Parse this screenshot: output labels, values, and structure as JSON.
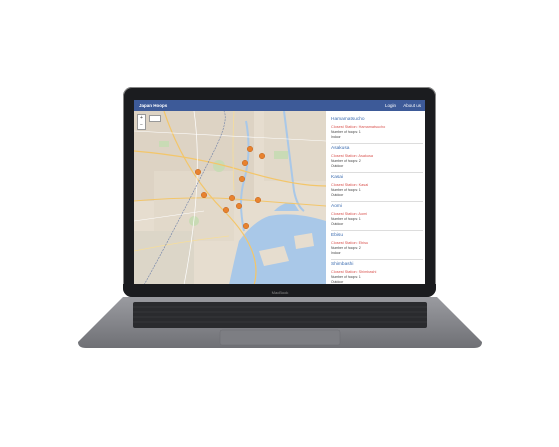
{
  "app": {
    "brand": "Japan Hoops",
    "nav": {
      "login": "Login",
      "about": "About us"
    }
  },
  "map": {
    "zoom_in": "+",
    "zoom_out": "−"
  },
  "places": [
    {
      "name": "Hamamatsucho",
      "closest": "Closest Station: Hamamatsucho",
      "number": "Number of hoops: 1",
      "status": "Indoor"
    },
    {
      "name": "Asakusa",
      "closest": "Closest Station: Asakusa",
      "number": "Number of hoops: 2",
      "status": "Outdoor"
    },
    {
      "name": "Kasai",
      "closest": "Closest Station: Kasai",
      "number": "Number of hoops: 1",
      "status": "Outdoor"
    },
    {
      "name": "Aomi",
      "closest": "Closest Station: Aomi",
      "number": "Number of hoops: 1",
      "status": "Outdoor"
    },
    {
      "name": "Ebisu",
      "closest": "Closest Station: Ebisu",
      "number": "Number of hoops: 2",
      "status": "Indoor"
    },
    {
      "name": "Shimbashi",
      "closest": "Closest Station: Shimbashi",
      "number": "Number of hoops: 1",
      "status": "Outdoor"
    }
  ],
  "device": {
    "label": "MacBook"
  },
  "colors": {
    "navbar": "#3d5a98",
    "link": "#3d6db0",
    "station": "#d9534f",
    "marker": "#e8822e",
    "water": "#a9c8e8"
  }
}
